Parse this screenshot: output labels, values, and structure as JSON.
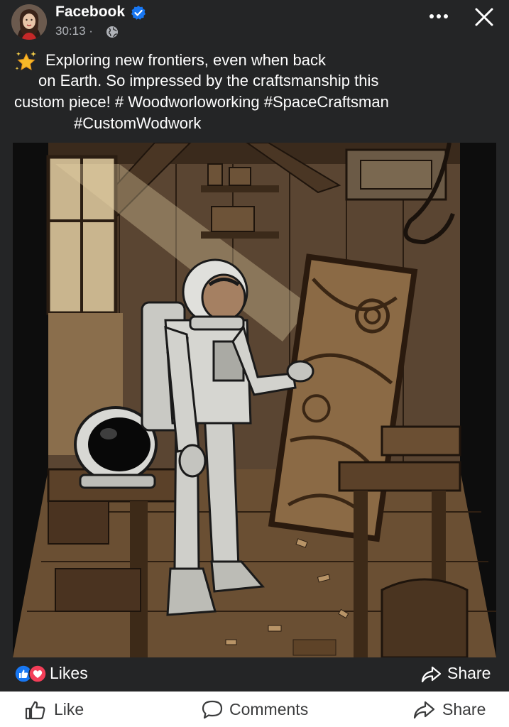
{
  "header": {
    "page_name": "Facebook",
    "time": "30:13 ·",
    "verified_icon": "verified-badge-icon",
    "privacy_icon": "globe-icon"
  },
  "post": {
    "caption_lines": [
      "Exploring new frontiers, even when back",
      "on Earth. So impressed by the craftsmanship this",
      "custom piece! # Woodworloworking #SpaceCraftsman",
      "#CustomWodwork"
    ],
    "emoji": "sparkle-star-emoji"
  },
  "reactions": {
    "label": "Likes",
    "share_label": "Share"
  },
  "actions": {
    "like": "Like",
    "comments": "Comments",
    "share": "Share"
  },
  "colors": {
    "background": "#242526",
    "facebook_blue": "#1877f2",
    "love_red": "#f33e58"
  }
}
